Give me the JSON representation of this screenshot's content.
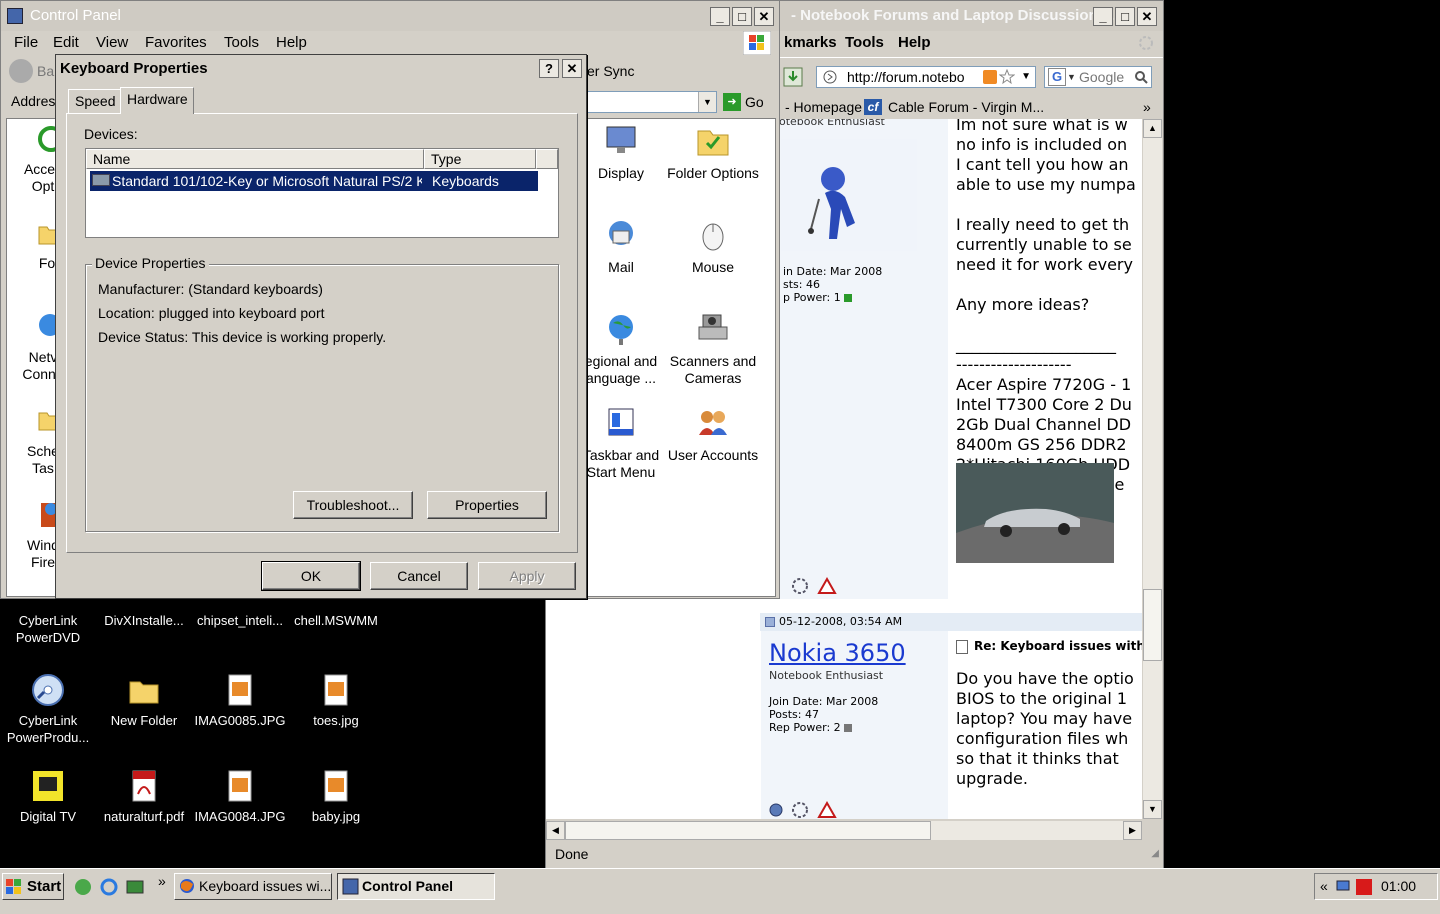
{
  "desktop": {
    "icons": [
      {
        "label": "CyberLink PowerDVD",
        "line1": "CyberLink",
        "line2": "PowerDVD"
      },
      {
        "label": "DivXInstalle...",
        "line1": "DivXInstalle...",
        "line2": ""
      },
      {
        "label": "chipset_inteli...",
        "line1": "chipset_inteli...",
        "line2": ""
      },
      {
        "label": "chell.MSWMM",
        "line1": "chell.MSWMM",
        "line2": ""
      },
      {
        "label": "CyberLink PowerProdu...",
        "line1": "CyberLink",
        "line2": "PowerProdu..."
      },
      {
        "label": "New Folder",
        "line1": "New Folder",
        "line2": ""
      },
      {
        "label": "IMAG0085.JPG",
        "line1": "IMAG0085.JPG",
        "line2": ""
      },
      {
        "label": "toes.jpg",
        "line1": "toes.jpg",
        "line2": ""
      },
      {
        "label": "Digital TV",
        "line1": "Digital TV",
        "line2": ""
      },
      {
        "label": "naturalturf.pdf",
        "line1": "naturalturf.pdf",
        "line2": ""
      },
      {
        "label": "IMAG0084.JPG",
        "line1": "IMAG0084.JPG",
        "line2": ""
      },
      {
        "label": "baby.jpg",
        "line1": "baby.jpg",
        "line2": ""
      }
    ]
  },
  "firefox": {
    "title": "- Notebook Forums and Laptop Discussion ...",
    "menu": [
      "kmarks",
      "Tools",
      "Help"
    ],
    "url": "http://forum.notebo",
    "search_placeholder": "Google",
    "bookmarks": [
      "- Homepage",
      "Cable Forum - Virgin M..."
    ],
    "bookmarks_more": "»",
    "status": "Done",
    "post1": {
      "user_role": "otebook Enthusiast",
      "join_date": "in Date: Mar 2008",
      "posts": "sts: 46",
      "rep": "p Power: 1",
      "lines": [
        "Im not sure what is w",
        "no info is included on",
        "I cant tell you how an",
        "able to use my numpa",
        "",
        "I really need to get th",
        "currently unable to se",
        "need it for work every",
        "",
        "Any more ideas?",
        "",
        "____________________",
        "--------------------",
        "Acer Aspire 7720G - 1",
        "Intel T7300 Core 2 Du",
        "2Gb Dual Channel DD",
        "8400m GS 256 DDR2",
        "2*Hitachi 160Gb HDD",
        "Windows Vista Home"
      ]
    },
    "post2": {
      "date": "05-12-2008, 03:54 AM",
      "username": "Nokia 3650",
      "user_role": "Notebook Enthusiast",
      "join_date": "Join Date: Mar 2008",
      "posts": "Posts: 47",
      "rep": "Rep Power: 2",
      "subject": "Re: Keyboard issues with",
      "lines": [
        "Do you have the optio",
        "BIOS to the original 1",
        "laptop? You may have",
        "configuration files wh",
        "so that it thinks that",
        "upgrade."
      ]
    }
  },
  "control_panel": {
    "title": "Control Panel",
    "menu": [
      "File",
      "Edit",
      "View",
      "Favorites",
      "Tools",
      "Help"
    ],
    "toolbar_back": "Ba",
    "toolbar_sync": "er Sync",
    "address_label": "Address",
    "go_label": "Go",
    "left_labels": [
      {
        "l1": "Acces",
        "l2": "Opt"
      },
      {
        "l1": "Fo",
        "l2": ""
      },
      {
        "l1": "Netv",
        "l2": "Conne"
      },
      {
        "l1": "Sche",
        "l2": "Tas"
      },
      {
        "l1": "Wind",
        "l2": "Fire"
      }
    ],
    "icons": [
      {
        "l1": "Display",
        "l2": ""
      },
      {
        "l1": "Folder Options",
        "l2": ""
      },
      {
        "l1": "Mail",
        "l2": ""
      },
      {
        "l1": "Mouse",
        "l2": ""
      },
      {
        "l1": "egional and",
        "l2": "anguage ..."
      },
      {
        "l1": "Scanners and",
        "l2": "Cameras"
      },
      {
        "l1": "Taskbar and",
        "l2": "Start Menu"
      },
      {
        "l1": "User Accounts",
        "l2": ""
      }
    ]
  },
  "keyboard_dialog": {
    "title": "Keyboard Properties",
    "tabs": [
      "Speed",
      "Hardware"
    ],
    "devices_label": "Devices:",
    "col_name": "Name",
    "col_type": "Type",
    "device_name": "Standard 101/102-Key or Microsoft Natural PS/2 Ke...",
    "device_type": "Keyboards",
    "group_title": "Device Properties",
    "manufacturer": "Manufacturer: (Standard keyboards)",
    "location": "Location: plugged into keyboard port",
    "status": "Device Status: This device is working properly.",
    "troubleshoot": "Troubleshoot...",
    "properties": "Properties",
    "ok": "OK",
    "cancel": "Cancel",
    "apply": "Apply"
  },
  "taskbar": {
    "start": "Start",
    "tasks": [
      "Keyboard issues wi...",
      "Control Panel"
    ],
    "chevron": "»",
    "tray_chevron": "«",
    "clock": "01:00"
  }
}
